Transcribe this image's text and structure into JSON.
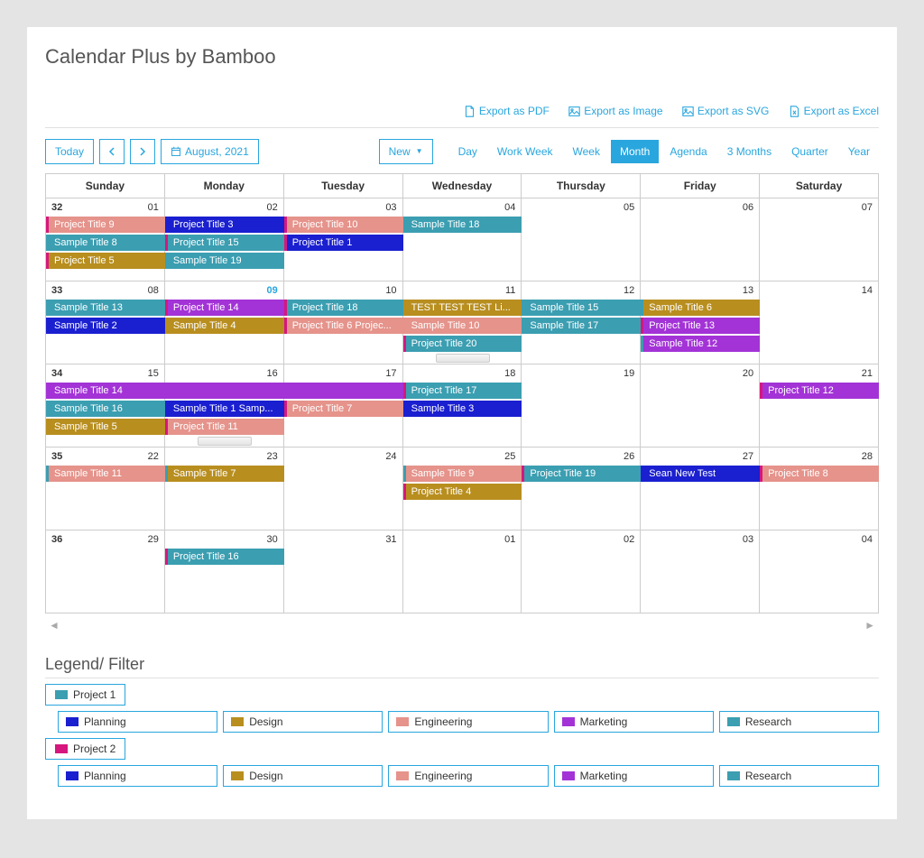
{
  "title": "Calendar Plus by Bamboo",
  "export": {
    "pdf": "Export as PDF",
    "image": "Export as Image",
    "svg": "Export as SVG",
    "excel": "Export as Excel"
  },
  "toolbar": {
    "today": "Today",
    "period": "August, 2021",
    "new": "New"
  },
  "views": [
    "Day",
    "Work Week",
    "Week",
    "Month",
    "Agenda",
    "3 Months",
    "Quarter",
    "Year"
  ],
  "active_view": "Month",
  "day_headers": [
    "Sunday",
    "Monday",
    "Tuesday",
    "Wednesday",
    "Thursday",
    "Friday",
    "Saturday"
  ],
  "colors": {
    "teal": "#3b9eb1",
    "blue": "#1a1fd0",
    "pink_dk": "#d6177e",
    "salmon": "#e5938b",
    "ochre": "#b88e1f",
    "purple": "#a333d6",
    "accent": "#29a6de"
  },
  "weeks": [
    {
      "num": "32",
      "days": [
        "01",
        "02",
        "03",
        "04",
        "05",
        "06",
        "07"
      ],
      "today_col": null,
      "events": [
        {
          "label": "Project Title 9",
          "color": "salmon",
          "col": 0,
          "span": 1,
          "row": 0,
          "stripe": "pink_dk"
        },
        {
          "label": "Project Title 3",
          "color": "blue",
          "col": 1,
          "span": 1,
          "row": 0
        },
        {
          "label": "Project Title 10",
          "color": "salmon",
          "col": 2,
          "span": 1,
          "row": 0,
          "stripe": "pink_dk"
        },
        {
          "label": "Sample Title 18",
          "color": "teal",
          "col": 3,
          "span": 1,
          "row": 0
        },
        {
          "label": "Sample Title 8",
          "color": "teal",
          "col": 0,
          "span": 1,
          "row": 1
        },
        {
          "label": "Project Title 15",
          "color": "teal",
          "col": 1,
          "span": 1,
          "row": 1,
          "stripe": "pink_dk"
        },
        {
          "label": "Project Title 1",
          "color": "blue",
          "col": 2,
          "span": 1,
          "row": 1,
          "stripe": "pink_dk"
        },
        {
          "label": "Project Title 5",
          "color": "ochre",
          "col": 0,
          "span": 1,
          "row": 2,
          "stripe": "pink_dk"
        },
        {
          "label": "Sample Title 19",
          "color": "teal",
          "col": 1,
          "span": 1,
          "row": 2
        }
      ]
    },
    {
      "num": "33",
      "days": [
        "08",
        "09",
        "10",
        "11",
        "12",
        "13",
        "14"
      ],
      "today_col": 1,
      "events": [
        {
          "label": "Sample Title 13",
          "color": "teal",
          "col": 0,
          "span": 1,
          "row": 0
        },
        {
          "label": "Project Title 14",
          "color": "purple",
          "col": 1,
          "span": 1,
          "row": 0,
          "stripe": "pink_dk"
        },
        {
          "label": "Project Title 18",
          "color": "teal",
          "col": 2,
          "span": 1,
          "row": 0,
          "stripe": "pink_dk"
        },
        {
          "label": "TEST TEST TEST Li...",
          "color": "ochre",
          "col": 3,
          "span": 1,
          "row": 0
        },
        {
          "label": "Sample Title 15",
          "color": "teal",
          "col": 4,
          "span": 1,
          "row": 0
        },
        {
          "label": "Sample Title 6",
          "color": "ochre",
          "col": 5,
          "span": 1,
          "row": 0,
          "stripe": "teal"
        },
        {
          "label": "Sample Title 2",
          "color": "blue",
          "col": 0,
          "span": 1,
          "row": 1
        },
        {
          "label": "Sample Title 4",
          "color": "ochre",
          "col": 1,
          "span": 1,
          "row": 1
        },
        {
          "label": "Project Title 6 Projec...",
          "color": "salmon",
          "col": 2,
          "span": 1,
          "row": 1,
          "stripe": "pink_dk"
        },
        {
          "label": "Sample Title 10",
          "color": "salmon",
          "col": 3,
          "span": 1,
          "row": 1
        },
        {
          "label": "Sample Title 17",
          "color": "teal",
          "col": 4,
          "span": 1,
          "row": 1
        },
        {
          "label": "Project Title 13",
          "color": "purple",
          "col": 5,
          "span": 1,
          "row": 1,
          "stripe": "pink_dk"
        },
        {
          "label": "Project Title 20",
          "color": "teal",
          "col": 3,
          "span": 1,
          "row": 2,
          "stripe": "pink_dk"
        },
        {
          "label": "Sample Title 12",
          "color": "purple",
          "col": 5,
          "span": 1,
          "row": 2,
          "stripe": "teal"
        }
      ],
      "more_handles": [
        {
          "col": 3,
          "row": 3
        }
      ]
    },
    {
      "num": "34",
      "days": [
        "15",
        "16",
        "17",
        "18",
        "19",
        "20",
        "21"
      ],
      "today_col": null,
      "events": [
        {
          "label": "Sample Title 14",
          "color": "purple",
          "col": 0,
          "span": 3,
          "row": 0
        },
        {
          "label": "Project Title 17",
          "color": "teal",
          "col": 3,
          "span": 1,
          "row": 0,
          "stripe": "pink_dk"
        },
        {
          "label": "Project Title 12",
          "color": "purple",
          "col": 6,
          "span": 1,
          "row": 0,
          "stripe": "pink_dk"
        },
        {
          "label": "Sample Title 16",
          "color": "teal",
          "col": 0,
          "span": 1,
          "row": 1
        },
        {
          "label": "Sample Title 1 Samp...",
          "color": "blue",
          "col": 1,
          "span": 1,
          "row": 1
        },
        {
          "label": "Project Title 7",
          "color": "salmon",
          "col": 2,
          "span": 1,
          "row": 1,
          "stripe": "pink_dk"
        },
        {
          "label": "Sample Title 3",
          "color": "blue",
          "col": 3,
          "span": 1,
          "row": 1
        },
        {
          "label": "Sample Title 5",
          "color": "ochre",
          "col": 0,
          "span": 1,
          "row": 2
        },
        {
          "label": "Project Title 11",
          "color": "salmon",
          "col": 1,
          "span": 1,
          "row": 2,
          "stripe": "pink_dk"
        }
      ],
      "more_handles": [
        {
          "col": 1,
          "row": 3
        }
      ]
    },
    {
      "num": "35",
      "days": [
        "22",
        "23",
        "24",
        "25",
        "26",
        "27",
        "28"
      ],
      "today_col": null,
      "events": [
        {
          "label": "Sample Title 11",
          "color": "salmon",
          "col": 0,
          "span": 1,
          "row": 0,
          "stripe": "teal"
        },
        {
          "label": "Sample Title 7",
          "color": "ochre",
          "col": 1,
          "span": 1,
          "row": 0,
          "stripe": "teal"
        },
        {
          "label": "Sample Title 9",
          "color": "salmon",
          "col": 3,
          "span": 1,
          "row": 0,
          "stripe": "teal"
        },
        {
          "label": "Project Title 19",
          "color": "teal",
          "col": 4,
          "span": 1,
          "row": 0,
          "stripe": "pink_dk"
        },
        {
          "label": "Sean New Test",
          "color": "blue",
          "col": 5,
          "span": 1,
          "row": 0
        },
        {
          "label": "Project Title 8",
          "color": "salmon",
          "col": 6,
          "span": 1,
          "row": 0,
          "stripe": "pink_dk"
        },
        {
          "label": "Project Title 4",
          "color": "ochre",
          "col": 3,
          "span": 1,
          "row": 1,
          "stripe": "pink_dk"
        }
      ]
    },
    {
      "num": "36",
      "days": [
        "29",
        "30",
        "31",
        "01",
        "02",
        "03",
        "04"
      ],
      "today_col": null,
      "events": [
        {
          "label": "Project Title 16",
          "color": "teal",
          "col": 1,
          "span": 1,
          "row": 0,
          "stripe": "pink_dk"
        }
      ]
    }
  ],
  "legend": {
    "title": "Legend/ Filter",
    "groups": [
      {
        "name": "Project 1",
        "swatch": "teal",
        "cats": [
          {
            "name": "Planning",
            "swatch": "blue"
          },
          {
            "name": "Design",
            "swatch": "ochre"
          },
          {
            "name": "Engineering",
            "swatch": "salmon"
          },
          {
            "name": "Marketing",
            "swatch": "purple"
          },
          {
            "name": "Research",
            "swatch": "teal"
          }
        ]
      },
      {
        "name": "Project 2",
        "swatch": "pink_dk",
        "cats": [
          {
            "name": "Planning",
            "swatch": "blue"
          },
          {
            "name": "Design",
            "swatch": "ochre"
          },
          {
            "name": "Engineering",
            "swatch": "salmon"
          },
          {
            "name": "Marketing",
            "swatch": "purple"
          },
          {
            "name": "Research",
            "swatch": "teal"
          }
        ]
      }
    ]
  }
}
